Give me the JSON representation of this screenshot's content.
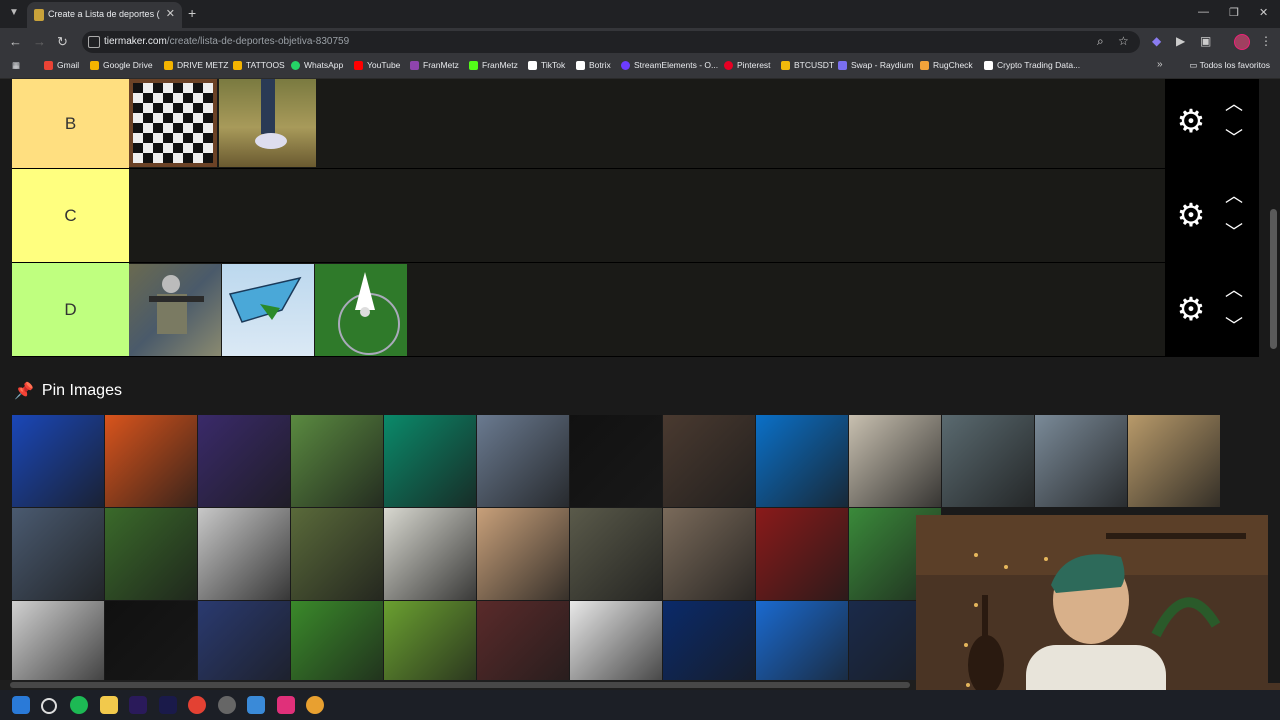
{
  "browser": {
    "tab_title": "Create a Lista de deportes (obj...",
    "tab_close": "✕",
    "new_tab": "+",
    "url_host": "tiermaker.com",
    "url_path": "/create/lista-de-deportes-objetiva-830759",
    "window_controls": [
      "—",
      "❐",
      "✕"
    ],
    "nav": {
      "back": "←",
      "forward": "→",
      "reload": "↻"
    },
    "toolbar_icons": {
      "zoom": "⌕",
      "star": "☆"
    }
  },
  "bookmarks": [
    {
      "label": "Gmail",
      "color": "#ea4335"
    },
    {
      "label": "Google Drive",
      "color": "#f4b400"
    },
    {
      "label": "DRIVE METZ",
      "color": "#f4b400"
    },
    {
      "label": "TATTOOS",
      "color": "#f4b400"
    },
    {
      "label": "WhatsApp",
      "color": "#25d366"
    },
    {
      "label": "YouTube",
      "color": "#ff0000"
    },
    {
      "label": "FranMetz",
      "color": "#8e44ad"
    },
    {
      "label": "FranMetz",
      "color": "#53fc18"
    },
    {
      "label": "TikTok",
      "color": "#ffffff"
    },
    {
      "label": "Botrix",
      "color": "#ffffff"
    },
    {
      "label": "StreamElements - O...",
      "color": "#6c3cff"
    },
    {
      "label": "Pinterest",
      "color": "#e60023"
    },
    {
      "label": "BTCUSDT",
      "color": "#f0b90b"
    },
    {
      "label": "Swap - Raydium",
      "color": "#7a6ff0"
    },
    {
      "label": "RugCheck",
      "color": "#f2a33a"
    },
    {
      "label": "Crypto Trading Data...",
      "color": "#ffffff"
    }
  ],
  "bookmarks_more": "»",
  "bookmarks_folder": "Todos los favoritos",
  "tiers": [
    {
      "label": "B",
      "color": "#ffdf80",
      "images": [
        "chess",
        "running-shoe"
      ]
    },
    {
      "label": "C",
      "color": "#ffff7f",
      "images": []
    },
    {
      "label": "D",
      "color": "#bfff7f",
      "images": [
        "airsoft",
        "hang-gliding",
        "badminton"
      ]
    }
  ],
  "controls": {
    "gear": "⚙",
    "up": "︿",
    "down": "﹀"
  },
  "pin": {
    "icon": "📌",
    "title": "Pin Images"
  },
  "pool_rows": [
    [
      "#1a47b8",
      "#d9541c",
      "#3a2a6a",
      "#5a8a40",
      "#0a8a6a",
      "#6a7a90",
      "#111111",
      "#4a3a30",
      "#0a70c8",
      "#c8c0b0",
      "#5a6a70",
      "#7a8a98",
      "#b89a6a"
    ],
    [
      "#4a5a70",
      "#3a6a2a",
      "#c8c8c8",
      "#5a6a3a",
      "#d8d8d0",
      "#c8a07a",
      "#5a5a4a",
      "#7a6a5a",
      "#8a1a1a",
      "#3a8a3a"
    ],
    [
      "#d0d0d0",
      "#101010",
      "#2a3a70",
      "#3a8a2a",
      "#6aa030",
      "#5a2a2a",
      "#e8e8e8",
      "#0a2a6a",
      "#1a6ad0",
      "#1a2a4a"
    ]
  ]
}
